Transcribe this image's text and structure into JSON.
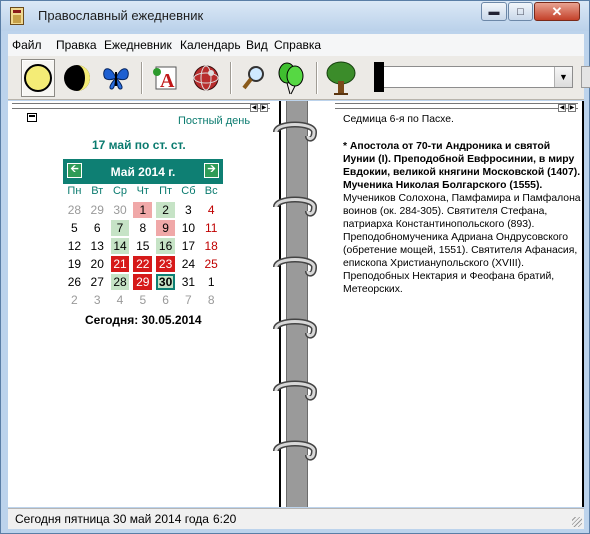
{
  "window": {
    "title": "Православный ежедневник",
    "icons": {
      "min": "minimize-icon",
      "max": "maximize-icon",
      "close": "close-icon"
    }
  },
  "menu": [
    "Файл",
    "Правка",
    "Ежедневник",
    "Календарь",
    "Вид",
    "Справка"
  ],
  "toolbar": {
    "icons": [
      "full-moon-icon",
      "crescent-moon-icon",
      "butterfly-icon",
      "letter-a-icon",
      "globe-icon",
      "magnifier-icon",
      "balloons-icon",
      "tree-icon"
    ],
    "combo_value": ""
  },
  "left": {
    "fast_label": "Постный день",
    "old_style_date": "17 май по ст. ст.",
    "calendar": {
      "month_label": "Май 2014 г.",
      "weekdays": [
        "Пн",
        "Вт",
        "Ср",
        "Чт",
        "Пт",
        "Сб",
        "Вс"
      ],
      "days": [
        "28",
        "29",
        "30",
        "1",
        "2",
        "3",
        "4",
        "5",
        "6",
        "7",
        "8",
        "9",
        "10",
        "11",
        "12",
        "13",
        "14",
        "15",
        "16",
        "17",
        "18",
        "19",
        "20",
        "21",
        "22",
        "23",
        "24",
        "25",
        "26",
        "27",
        "28",
        "29",
        "30",
        "31",
        "1",
        "2",
        "3",
        "4",
        "5",
        "6",
        "7",
        "8"
      ]
    },
    "today_label": "Сегодня: 30.05.2014"
  },
  "right": {
    "week": "Седмица 6-я по Пасхе.",
    "saints_bold": "* Апостола от 70-ти Андроника и святой Иунии (I). Преподобной Евфросинии, в миру Евдокии, великой княгини Московской (1407). Мученика Николая Болгарского (1555).",
    "saints_regular": "Мучеников Солохона, Памфамира и Памфалона воинов (ок. 284-305). Святителя Стефана, патриарха Константинопольского (893). Преподобномученика Адриана Ондрусовского (обретение мощей, 1551). Святителя Афанасия, епископа Христиан­упольского (XVIII). Преподобных Нектария и Феофана братий, Метеорских."
  },
  "status": {
    "text": "Сегодня пятница 30 май 2014 года",
    "time": "6:20"
  },
  "colors": {
    "accent": "#0e7f73",
    "fast_red": "#d61a1a",
    "green_cell": "#c6e3c6"
  }
}
